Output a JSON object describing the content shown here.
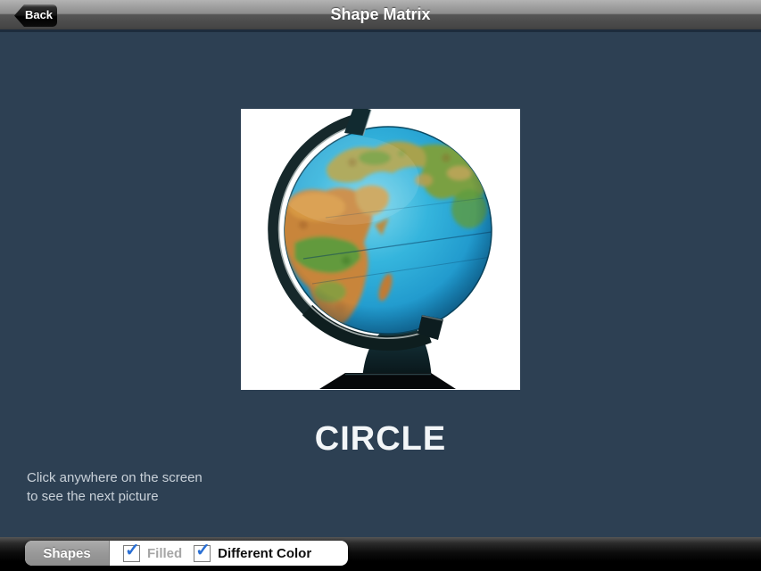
{
  "header": {
    "back_label": "Back",
    "title": "Shape Matrix"
  },
  "main": {
    "shape_label": "CIRCLE",
    "image_subject": "world desk globe photo",
    "instruction_line1": "Click anywhere on the screen",
    "instruction_line2": "to see the next picture"
  },
  "toolbar": {
    "shapes_label": "Shapes",
    "checkboxes": [
      {
        "label": "Filled",
        "checked": true
      },
      {
        "label": "Different Color",
        "checked": true
      }
    ]
  },
  "icons": {
    "check_glyph": "✓"
  },
  "colors": {
    "background": "#2d4053",
    "checkmark_blue": "#2a6fd4",
    "navbar_gray": "#8c8c8c",
    "toolbar_black": "#000000"
  }
}
